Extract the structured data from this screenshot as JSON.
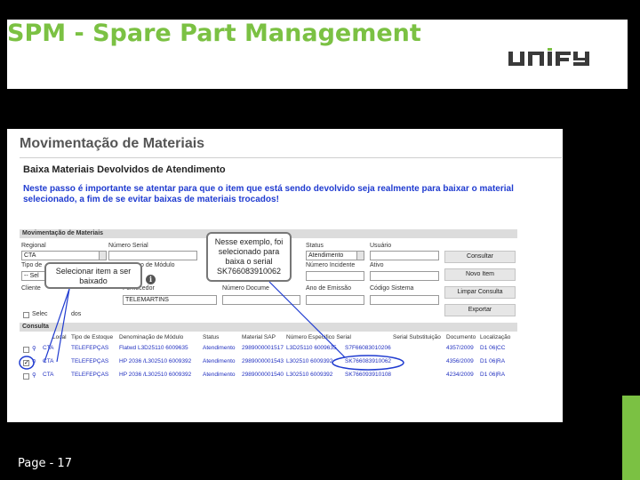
{
  "slide": {
    "title": "SPM - Spare Part Management",
    "logo_text": "UNIFY",
    "page_label": "Page - 17",
    "accent_color": "#7bc143"
  },
  "screen": {
    "title": "Movimentação de Materiais",
    "subtitle": "Baixa Materiais Devolvidos de Atendimento",
    "warning": "Neste passo é importante se atentar para que o item que está sendo devolvido seja realmente para baixar o material selecionado, a fim de se evitar baixas de materiais trocados!",
    "panel_title": "Movimentação de Materiais",
    "fields": {
      "regional_label": "Regional",
      "regional_value": "CTA",
      "numero_serial_label": "Número Serial",
      "status_label": "Status",
      "status_value": "Atendimento",
      "usuario_label": "Usuário",
      "tipo_label": "Tipo de",
      "tipo_value": "-- Sel",
      "modulo_label": "o de Módulo",
      "numero_incidente_label": "Número Incidente",
      "ativo_label": "Ativo",
      "cliente_label": "Cliente",
      "fornecedor_label": "Fornecedor",
      "fornecedor_value": "TELEMARTINS",
      "numero_documento_label": "Número Docume",
      "ano_emissao_label": "Ano de Emissão",
      "codigo_sistema_label": "Código Sistema",
      "selecionar_label": "Selec",
      "todos_label": "dos"
    },
    "buttons": {
      "consultar": "Consultar",
      "novo": "Novo Item",
      "limpar": "Limpar Consulta",
      "exportar": "Exportar"
    },
    "table": {
      "title": "Consulta",
      "columns": [
        "Local",
        "Tipo de Estoque",
        "Denominação de Módulo",
        "Status",
        "Material SAP",
        "Número Especifico Serial",
        "Serial Substituição",
        "Documento",
        "Localização"
      ],
      "rows": [
        [
          "CTA",
          "TELEFEPÇAS",
          "Flatwd L3D25110 6009635",
          "Atendimento",
          "2989000001517",
          "L3D25110 6009635",
          "S7F66083010206",
          "4357/2009",
          "D1 06|CC"
        ],
        [
          "CTA",
          "TELEFEPÇAS",
          "HP 2036 /L302510 6009392",
          "Atendimento",
          "2989000001543",
          "L302510 6009392",
          "SK766083910062",
          "4356/2009",
          "D1 06|RA"
        ],
        [
          "CTA",
          "TELEFEPÇAS",
          "HP 2036 /L302510 6009392",
          "Atendimento",
          "2989000001540",
          "L302510 6009392",
          "SK766093910108",
          "4234/2009",
          "D1 06|RA"
        ]
      ]
    },
    "callouts": {
      "select_item": "Selecionar item a ser baixado",
      "example": "Nesse exemplo, foi selecionado para baixa o serial SK766083910062"
    }
  }
}
